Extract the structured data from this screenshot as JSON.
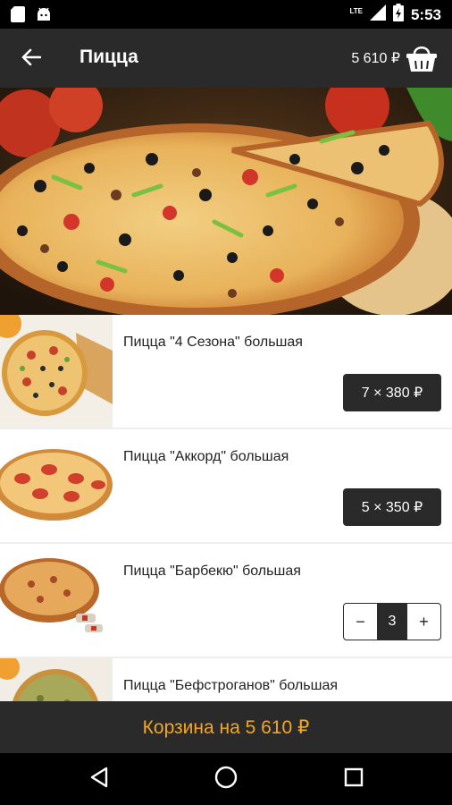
{
  "status_bar": {
    "time": "5:53",
    "network_label": "LTE",
    "icons": [
      "sd-card-icon",
      "android-icon",
      "signal-icon",
      "battery-icon"
    ]
  },
  "app_bar": {
    "title": "Пицца",
    "cart_total": "5 610 ₽",
    "icons": [
      "back-arrow-icon",
      "basket-icon"
    ]
  },
  "products": [
    {
      "name": "Пицца \"4 Сезона\" большая",
      "control": "price",
      "price_label": "7 × 380 ₽"
    },
    {
      "name": "Пицца \"Аккорд\" большая",
      "control": "price",
      "price_label": "5 × 350 ₽"
    },
    {
      "name": "Пицца \"Барбекю\" большая",
      "control": "stepper",
      "quantity": "3",
      "minus": "−",
      "plus": "+"
    },
    {
      "name": "Пицца \"Бефстроганов\" большая"
    }
  ],
  "cart_bar": {
    "label": "Корзина на 5 610 ₽"
  },
  "nav_bar": {
    "icons": [
      "back-triangle-icon",
      "home-circle-icon",
      "recents-square-icon"
    ]
  },
  "colors": {
    "app_bar": "#2a2a2a",
    "accent": "#f5a623",
    "status_bar": "#000000"
  }
}
